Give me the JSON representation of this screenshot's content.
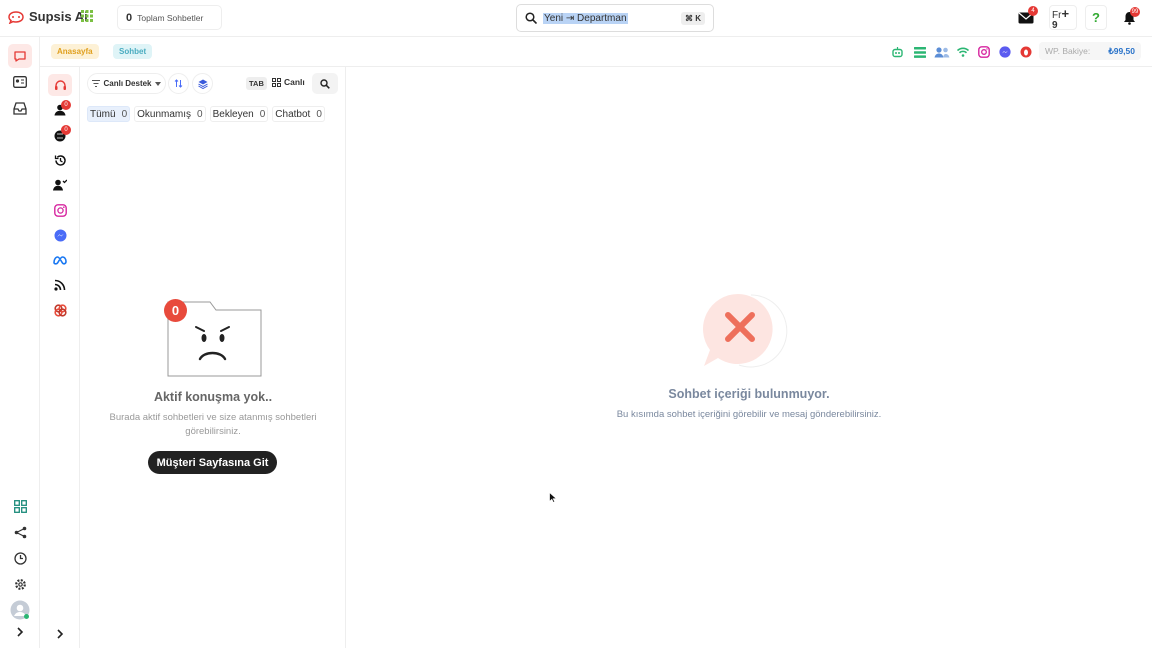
{
  "brand": {
    "name": "Supsis Ai",
    "accent": "#e53935"
  },
  "header": {
    "total_count": "0",
    "total_label": "Toplam Sohbetler",
    "search_value": "Yeni ⇥ Departman",
    "search_shortcut": "⌘ K",
    "mail_badge": "4",
    "lang": "Fr",
    "lang_sub": "9",
    "plus": "+",
    "help": "?",
    "notif_badge": "99"
  },
  "breadcrumb": {
    "home": "Anasayfa",
    "current": "Sohbet"
  },
  "channels": [
    "bot-icon",
    "list-icon",
    "agents-icon",
    "wifi-icon",
    "instagram-icon",
    "messenger-icon",
    "opera-icon"
  ],
  "balance": {
    "label": "WP. Bakiye:",
    "value": "₺99,50"
  },
  "sidebar_badges": {
    "queue": "0",
    "transfer": "0"
  },
  "list": {
    "department": "Canlı Destek",
    "tab_label": "TAB",
    "live_label": "Canlı",
    "filters": [
      {
        "label": "Tümü",
        "count": "0"
      },
      {
        "label": "Okunmamış",
        "count": "0"
      },
      {
        "label": "Bekleyen",
        "count": "0"
      },
      {
        "label": "Chatbot",
        "count": "0"
      }
    ],
    "empty_badge": "0",
    "empty_title": "Aktif konuşma yok..",
    "empty_desc": "Burada aktif sohbetleri ve size atanmış sohbetleri görebilirsiniz.",
    "empty_button": "Müşteri Sayfasına Git"
  },
  "main": {
    "empty_title": "Sohbet içeriği bulunmuyor.",
    "empty_desc": "Bu kısımda sohbet içeriğini görebilir ve mesaj gönderebilirsiniz."
  }
}
